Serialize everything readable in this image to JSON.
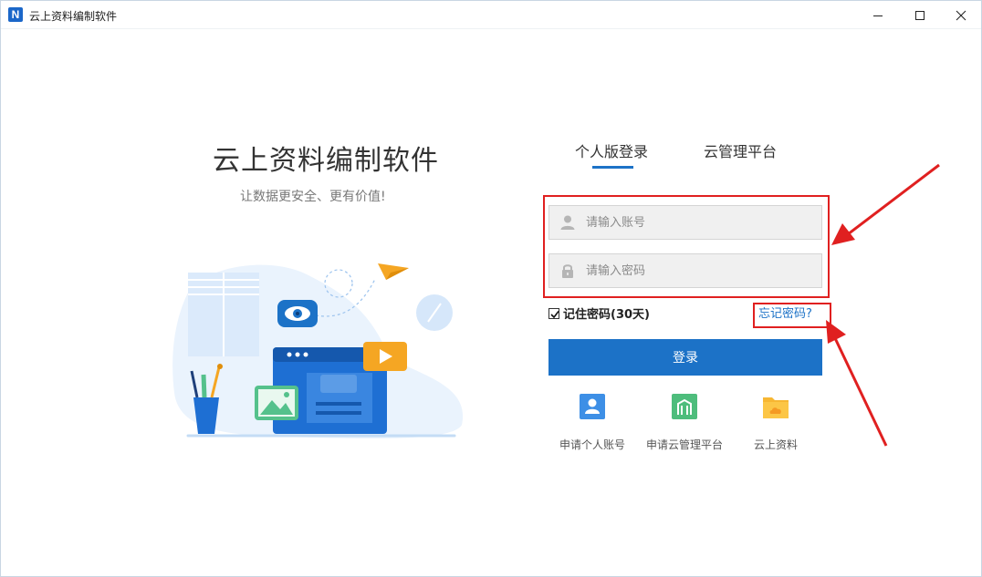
{
  "window": {
    "logo_letter": "N",
    "title": "云上资料编制软件"
  },
  "brand": {
    "title": "云上资料编制软件",
    "slogan": "让数据更安全、更有价值!"
  },
  "tabs": [
    {
      "label": "个人版登录",
      "active": true
    },
    {
      "label": "云管理平台",
      "active": false
    }
  ],
  "form": {
    "username_placeholder": "请输入账号",
    "password_placeholder": "请输入密码",
    "remember_label": "记住密码(30天)",
    "remember_checked": true,
    "forgot_label": "忘记密码?",
    "login_label": "登录"
  },
  "quick_links": [
    {
      "label": "申请个人账号",
      "icon": "user-card-icon"
    },
    {
      "label": "申请云管理平台",
      "icon": "building-icon"
    },
    {
      "label": "云上资料",
      "icon": "cloud-folder-icon"
    }
  ],
  "colors": {
    "accent": "#1c72c7",
    "highlight": "#e02020"
  }
}
